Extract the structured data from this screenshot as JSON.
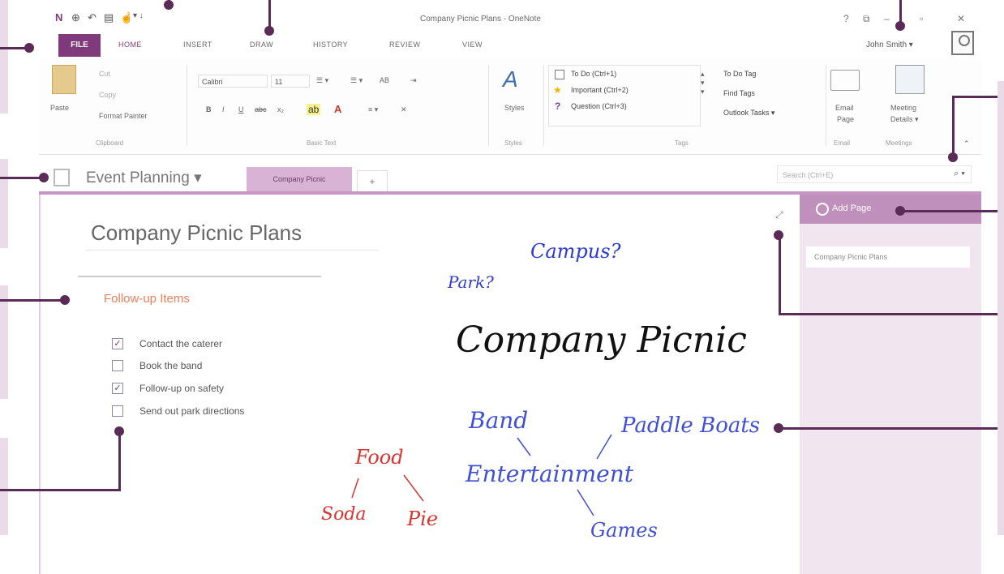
{
  "window": {
    "title": "Company Picnic Plans - OneNote"
  },
  "quick_access": {
    "back_icon": "back-icon",
    "undo_icon": "undo-icon",
    "dock_icon": "dock-icon",
    "touch_icon": "touch-icon",
    "overflow": "▾ ↓"
  },
  "window_controls": [
    "?",
    "⧉",
    "–",
    "▫",
    "✕"
  ],
  "ribbon_tabs": {
    "file": "FILE",
    "home": "HOME",
    "insert": "INSERT",
    "draw": "DRAW",
    "history": "HISTORY",
    "review": "REVIEW",
    "view": "VIEW"
  },
  "user": {
    "name": "John Smith ▾"
  },
  "clipboard": {
    "cut": "Cut",
    "copy": "Copy",
    "paste": "Paste",
    "format_painter": "Format Painter",
    "group": "Clipboard"
  },
  "basic_text": {
    "font": "Calibri",
    "size": "11",
    "group": "Basic Text",
    "bold": "B",
    "italic": "I",
    "underline": "U",
    "strike": "abc",
    "subscript": "x₂"
  },
  "styles": {
    "label": "Styles",
    "group": "Styles"
  },
  "tags": {
    "items": [
      "To Do (Ctrl+1)",
      "Important (Ctrl+2)",
      "Question (Ctrl+3)"
    ],
    "todo_tag": "To Do Tag",
    "find_tags": "Find Tags",
    "outlook_tasks": "Outlook Tasks ▾",
    "group": "Tags"
  },
  "email": {
    "label_line1": "Email",
    "label_line2": "Page",
    "group": "Email"
  },
  "meetings": {
    "label_line1": "Meeting",
    "label_line2": "Details ▾",
    "group": "Meetings"
  },
  "notebook": {
    "name": "Event Planning ▾",
    "section": "Company Picnic",
    "add_section": "+"
  },
  "search": {
    "placeholder": "Search (Ctrl+E)"
  },
  "page": {
    "title": "Company Picnic Plans"
  },
  "outline": {
    "heading": "Follow-up Items",
    "items": [
      {
        "text": "Contact the caterer",
        "checked": true
      },
      {
        "text": "Book the band",
        "checked": false
      },
      {
        "text": "Follow-up on safety",
        "checked": true
      },
      {
        "text": "Send out park directions",
        "checked": false
      }
    ]
  },
  "ink": {
    "campus": "Campus?",
    "park": "Park?",
    "company_picnic": "Company Picnic",
    "band": "Band",
    "paddle_boats": "Paddle Boats",
    "entertainment": "Entertainment",
    "games": "Games",
    "food": "Food",
    "soda": "Soda",
    "pie": "Pie"
  },
  "pages_pane": {
    "add_page": "Add Page",
    "pages": [
      "Company Picnic Plans"
    ]
  }
}
